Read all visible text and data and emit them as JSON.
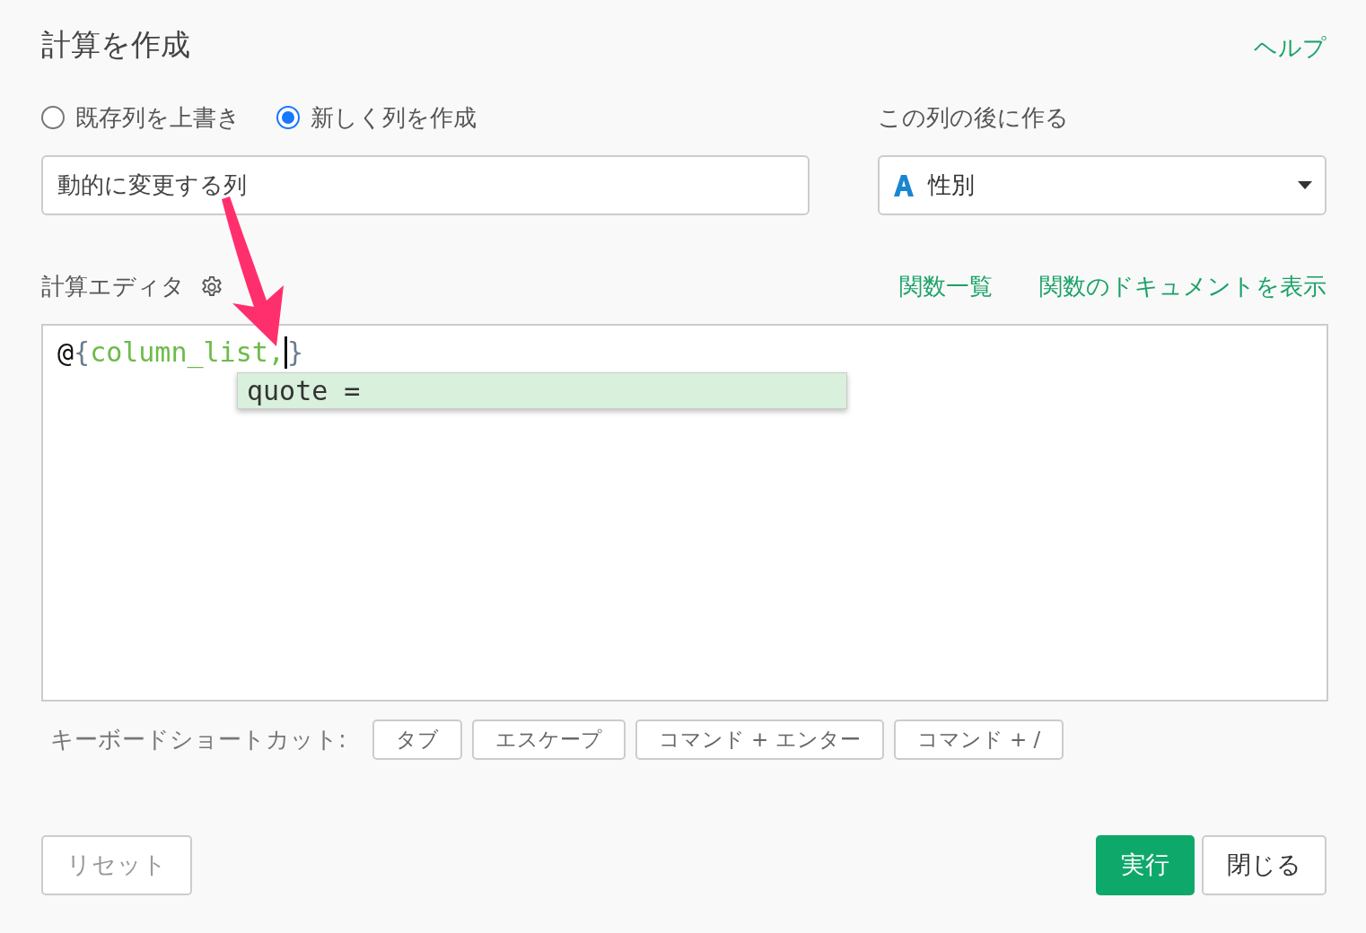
{
  "title": "計算を作成",
  "help_link": "ヘルプ",
  "mode_options": [
    {
      "label": "既存列を上書き",
      "selected": false
    },
    {
      "label": "新しく列を作成",
      "selected": true
    }
  ],
  "column_name": {
    "value": "動的に変更する列"
  },
  "insert_after": {
    "label": "この列の後に作る",
    "value": "性別"
  },
  "editor": {
    "label": "計算エディタ",
    "links": [
      "関数一覧",
      "関数のドキュメントを表示"
    ],
    "code": [
      {
        "kind": "symbol",
        "text": "@"
      },
      {
        "kind": "brace",
        "text": "{"
      },
      {
        "kind": "name",
        "text": "column_list,"
      },
      {
        "kind": "cursor"
      },
      {
        "kind": "brace",
        "text": "}"
      }
    ],
    "suggestions": [
      {
        "text": "quote =",
        "selected": true
      }
    ]
  },
  "shortcuts": {
    "label": "キーボードショートカット:",
    "keys": [
      "タブ",
      "エスケープ",
      "コマンド + エンター",
      "コマンド + /"
    ]
  },
  "buttons": [
    {
      "label": "リセット",
      "kind": "secondary"
    },
    {
      "label": "実行",
      "kind": "primary"
    },
    {
      "label": "閉じる",
      "kind": "secondary"
    }
  ]
}
